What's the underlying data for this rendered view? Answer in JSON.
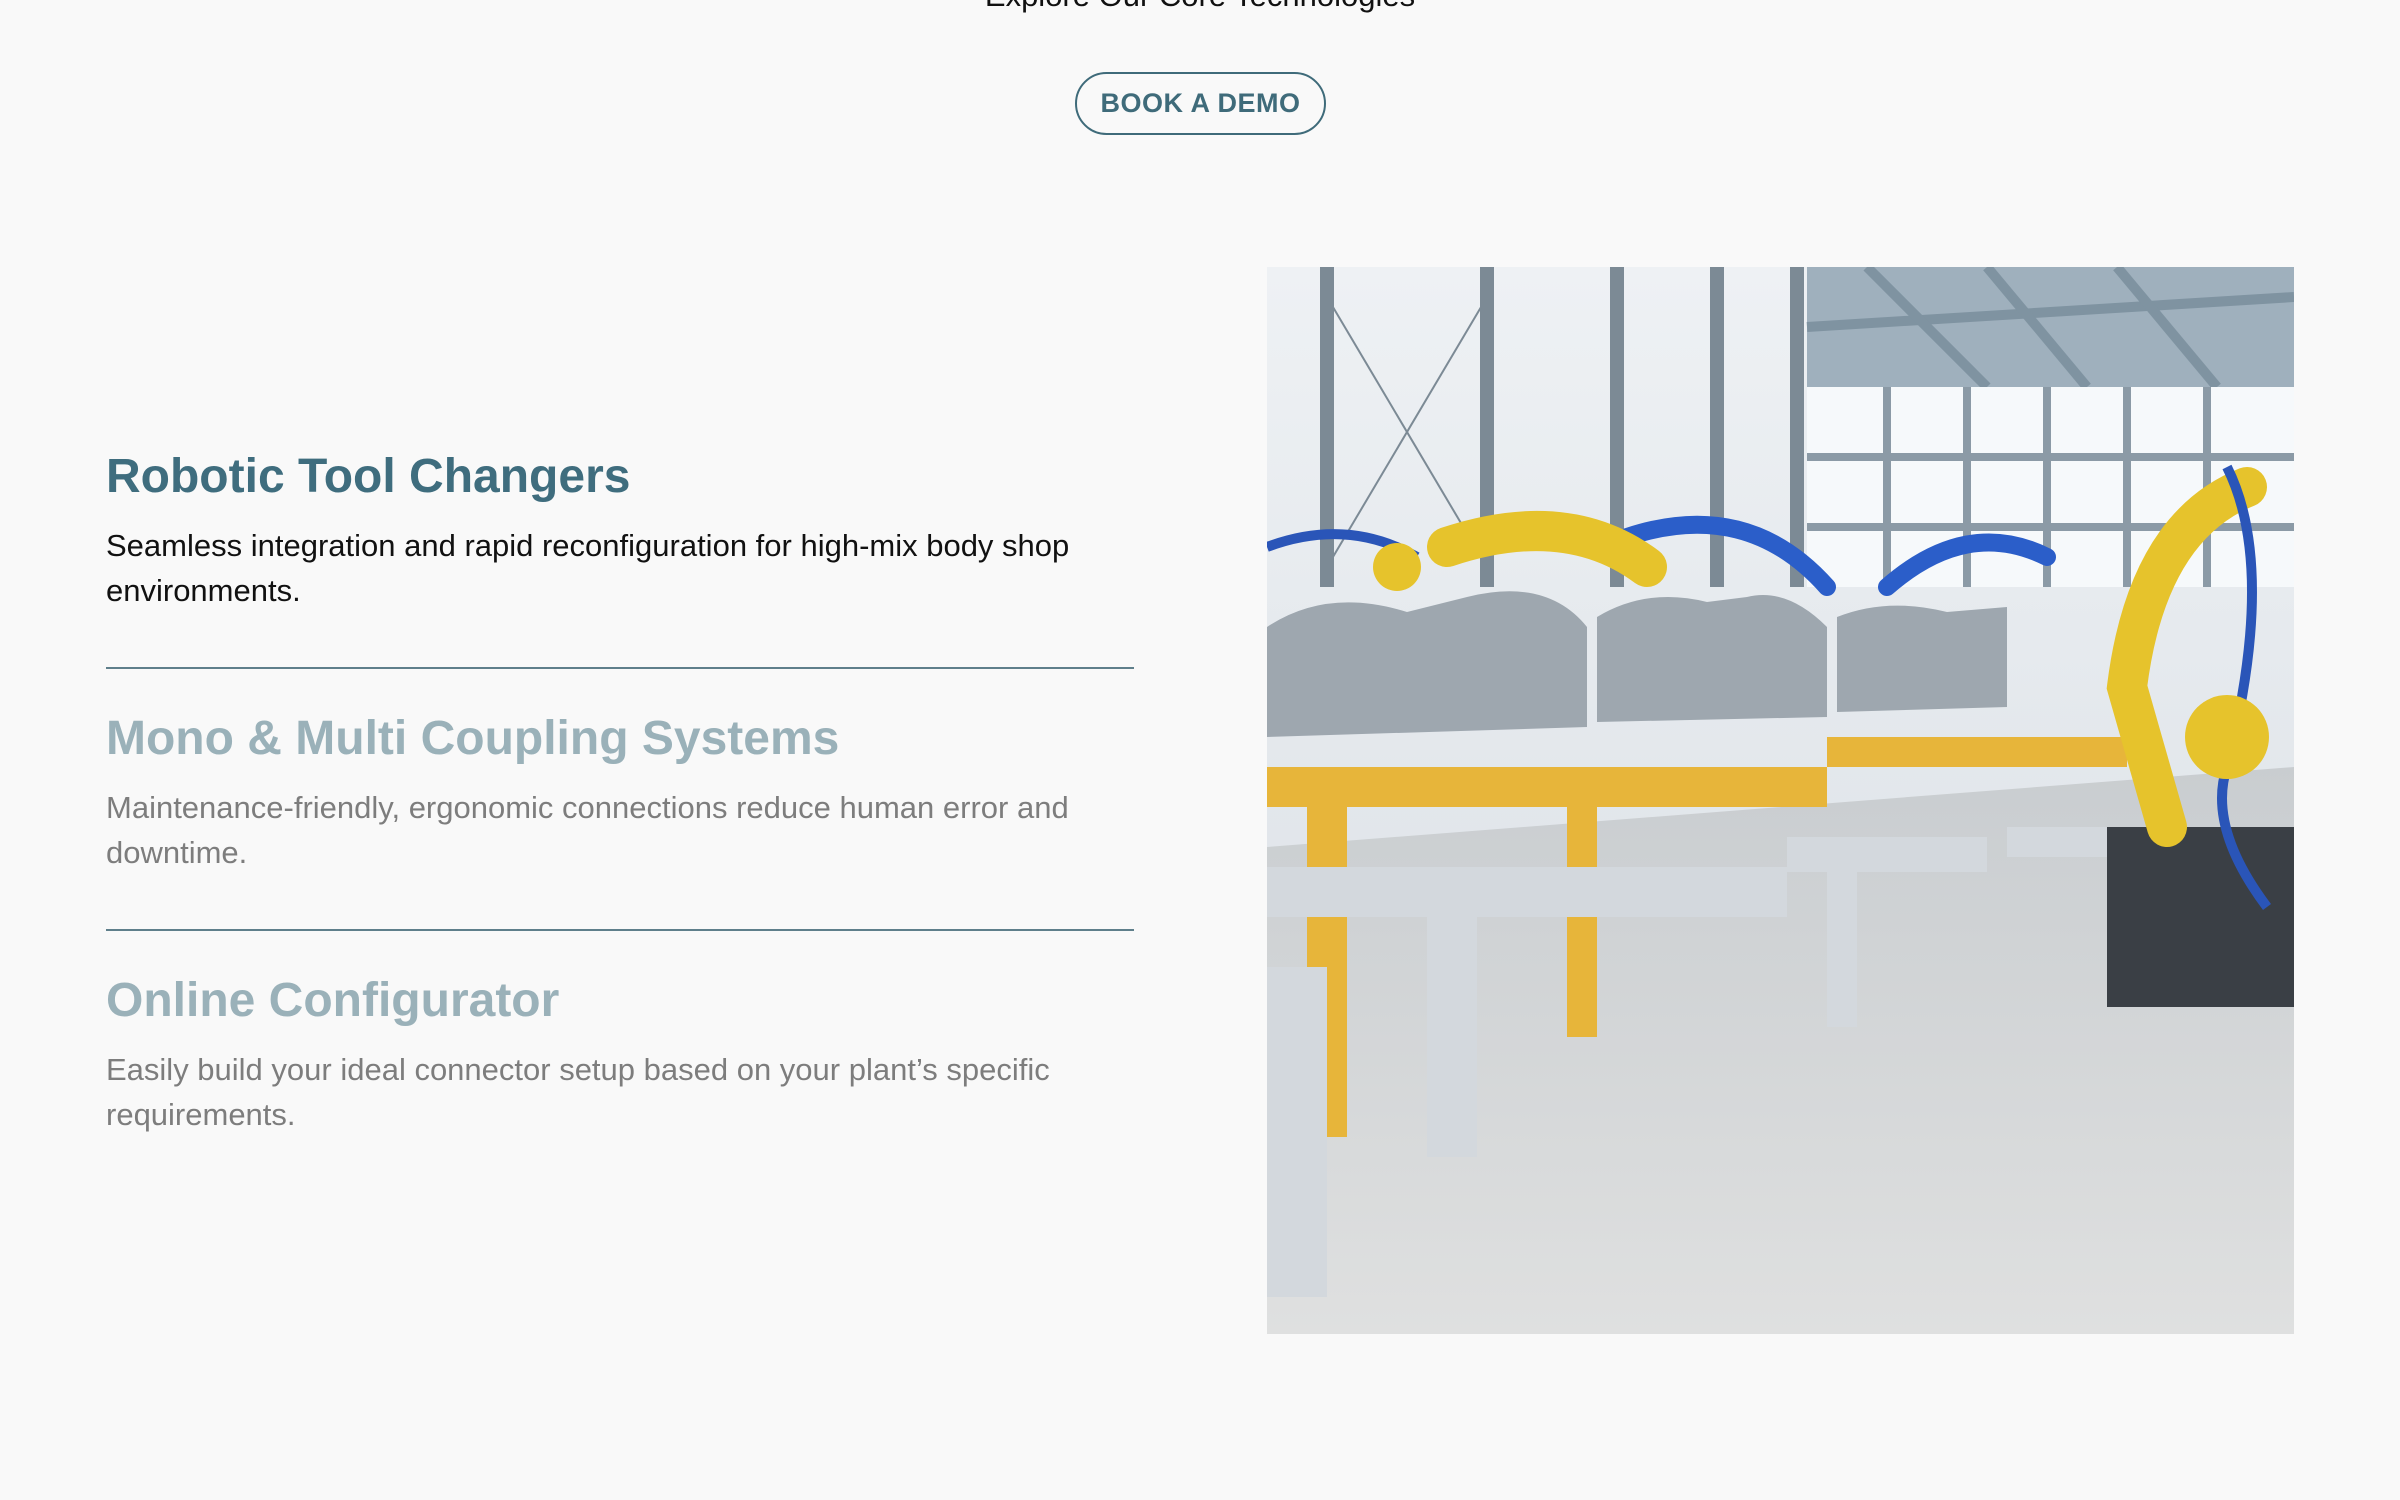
{
  "header": {
    "title": "Explore Our Core Technologies",
    "cta_label": "BOOK A DEMO"
  },
  "features": [
    {
      "title": "Robotic Tool Changers",
      "description": "Seamless integration and rapid reconfiguration for high-mix body shop environments.",
      "state": "active"
    },
    {
      "title": "Mono & Multi Coupling Systems",
      "description": "Maintenance-friendly, ergonomic connections reduce human error and downtime.",
      "state": "inactive"
    },
    {
      "title": "Online Configurator",
      "description": "Easily build your ideal connector setup based on your plant’s specific requirements.",
      "state": "inactive"
    }
  ],
  "colors": {
    "accent": "#3f6d7e",
    "inactive_title": "#9ab1b9",
    "inactive_text": "#7d7d7d",
    "background": "#f9f9f9"
  }
}
